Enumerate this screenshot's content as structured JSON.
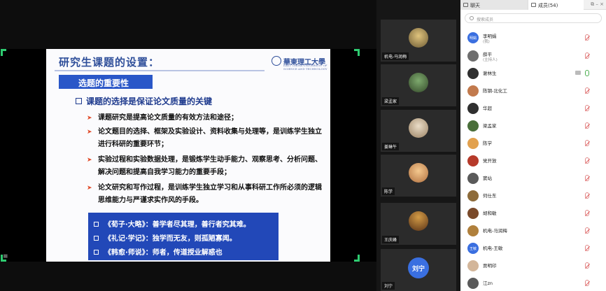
{
  "slide": {
    "title": "研究生课题的设置：",
    "logo_text": "華東理工大學",
    "logo_sub": "EAST CHINA UNIVERSITY OF SCIENCE AND TECHNOLOGY",
    "subheading": "选题的重要性",
    "key_point": "课题的选择是保证论文质量的关键",
    "bullets": [
      "课题研究是提高论文质量的有效方法和途径；",
      "论文题目的选择、框架及实验设计、资料收集与处理等，是训练学生独立进行科研的重要环节；",
      "实验过程和实验数据处理，是锻炼学生动手能力、观察思考、分析问题、解决问题和提高自我学习能力的重要手段；",
      "论文研究和写作过程，是训练学生独立学习和从事科研工作所必须的逻辑思维能力与严谨求实作风的手段。"
    ],
    "quotes": [
      "《荀子·大略》：善学者尽其理，善行者究其难。",
      "《礼记·学记》：独学而无友，则孤陋寡闻。",
      "《韩愈·师说》：师者，传道授业解惑也"
    ]
  },
  "video_tiles": [
    {
      "name": "机电-马润梅"
    },
    {
      "name": "梁孟家"
    },
    {
      "name": "姜琳午"
    },
    {
      "name": "陈学"
    },
    {
      "name": "王庆峰"
    },
    {
      "name": "刘宁",
      "avatar_text": "刘宁"
    }
  ],
  "panel": {
    "tab_chat": "聊天",
    "tab_members": "成员(54)",
    "search_placeholder": "搜索成员",
    "members": [
      {
        "name": "李明娟",
        "role": "(我)",
        "avatar_text": "明娟"
      },
      {
        "name": "薛平",
        "role": "(主持人)"
      },
      {
        "name": "谢林生"
      },
      {
        "name": "陈钢-北化工"
      },
      {
        "name": "华超"
      },
      {
        "name": "梁孟家"
      },
      {
        "name": "陈学"
      },
      {
        "name": "党开放"
      },
      {
        "name": "窦站"
      },
      {
        "name": "何仕东"
      },
      {
        "name": "胡和敏"
      },
      {
        "name": "机电-马润梅"
      },
      {
        "name": "机电-王敏",
        "avatar_text": "王敏"
      },
      {
        "name": "贾明印"
      },
      {
        "name": "江zn"
      }
    ]
  },
  "colors": {
    "slide_title": "#2f4f9a",
    "subheading_bg": "#2a57c8",
    "bullet_arrow": "#e04b2a",
    "quote_bg": "#2248b8",
    "share_border": "#2ecc71"
  }
}
